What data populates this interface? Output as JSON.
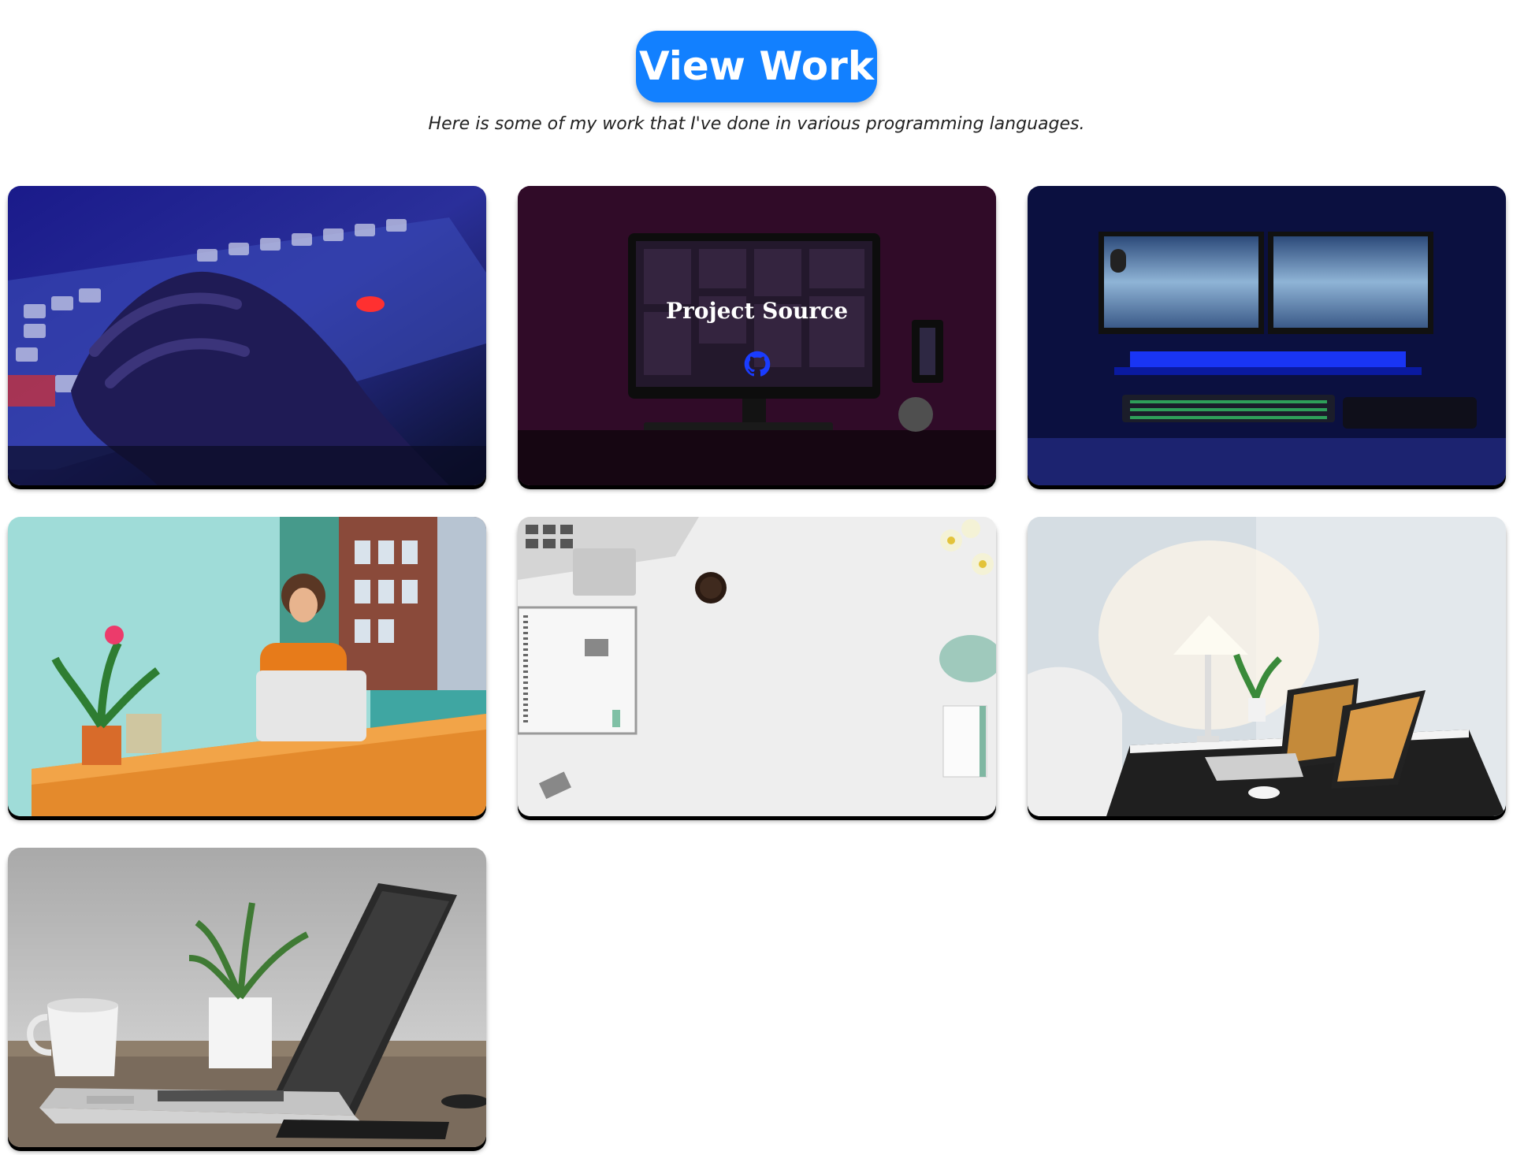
{
  "header": {
    "button_label": "View Work",
    "button_color": "#1280ff",
    "subtitle": "Here is some of my work that I've done in various programming languages."
  },
  "projects": [
    {
      "scene": "hand-on-keyboard-neon-photo",
      "hovered": false
    },
    {
      "scene": "pink-lit-desk-with-monitor-photo",
      "hovered": true,
      "overlay_title": "Project Source",
      "overlay_icon": "github-icon",
      "icon_color": "#1a3cff"
    },
    {
      "scene": "dual-monitor-blue-desk-photo",
      "hovered": false
    },
    {
      "scene": "woman-with-laptop-at-desk-photo",
      "hovered": false
    },
    {
      "scene": "white-desk-flatlay-photo",
      "hovered": false
    },
    {
      "scene": "desk-lamp-and-laptops-photo",
      "hovered": false
    },
    {
      "scene": "laptop-with-plant-and-mug-photo",
      "hovered": false
    }
  ]
}
